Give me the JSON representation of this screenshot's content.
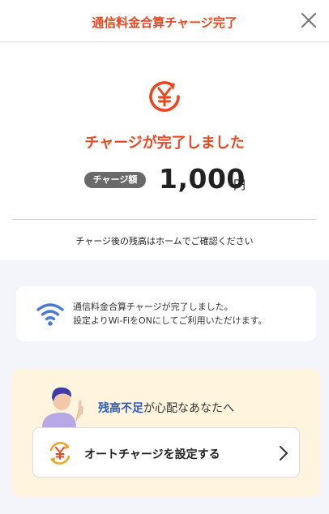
{
  "header": {
    "title": "通信料金合算チャージ完了",
    "close_icon": "close-icon"
  },
  "result": {
    "status_icon": "yen-refresh-icon",
    "title": "チャージが完了しました",
    "amount_badge": "チャージ額",
    "amount": "1,000",
    "unit": "円",
    "home_note": "チャージ後の残高はホームでご確認ください"
  },
  "wifi_notice": {
    "icon": "wifi-icon",
    "line1": "通信料金合算チャージが完了しました。",
    "line2": "設定よりWi-FiをONにしてご利用いただけます。"
  },
  "promo": {
    "avatar_icon": "person-icon",
    "title_em": "残高不足",
    "title_rest": "が心配なあなたへ",
    "auto_charge_icon": "auto-charge-yen-icon",
    "auto_charge_label": "オートチャージを設定する",
    "chevron_icon": "chevron-right-icon"
  },
  "colors": {
    "accent": "#e8481f",
    "link_blue": "#2c5bbf",
    "promo_bg": "#fff5de",
    "page_bg": "#f3f5fb"
  }
}
